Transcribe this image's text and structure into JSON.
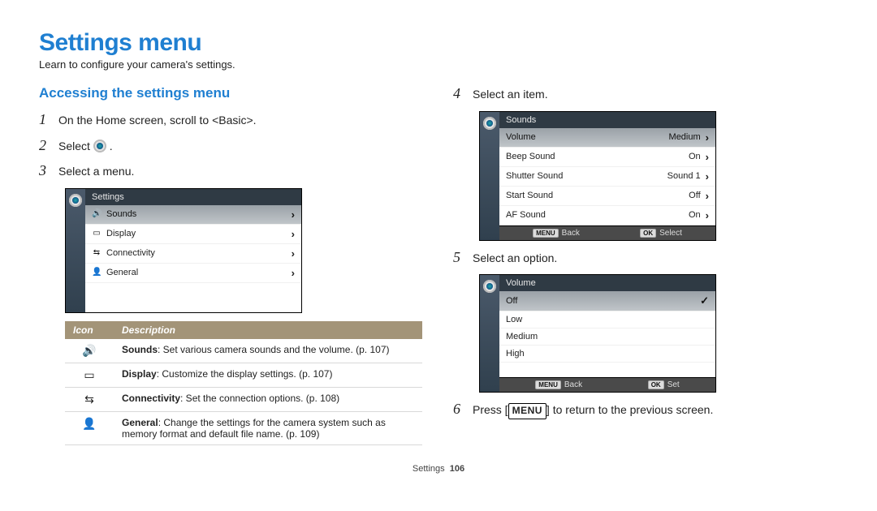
{
  "title": "Settings menu",
  "subtitle": "Learn to configure your camera's settings.",
  "section_heading": "Accessing the settings menu",
  "steps": {
    "s1": "On the Home screen, scroll to <Basic>.",
    "s2_pre": "Select",
    "s2_post": ".",
    "s3": "Select a menu.",
    "s4": "Select an item.",
    "s5": "Select an option.",
    "s6_pre": "Press [",
    "s6_btn": "MENU",
    "s6_post": "] to return to the previous screen."
  },
  "screen1": {
    "title": "Settings",
    "rows": [
      {
        "label": "Sounds",
        "selected": true
      },
      {
        "label": "Display",
        "selected": false
      },
      {
        "label": "Connectivity",
        "selected": false
      },
      {
        "label": "General",
        "selected": false
      }
    ]
  },
  "screen2": {
    "title": "Sounds",
    "rows": [
      {
        "label": "Volume",
        "value": "Medium",
        "selected": true
      },
      {
        "label": "Beep Sound",
        "value": "On",
        "selected": false
      },
      {
        "label": "Shutter Sound",
        "value": "Sound 1",
        "selected": false
      },
      {
        "label": "Start Sound",
        "value": "Off",
        "selected": false
      },
      {
        "label": "AF Sound",
        "value": "On",
        "selected": false
      }
    ],
    "footer": {
      "back": "Back",
      "menu_badge": "MENU",
      "ok_badge": "OK",
      "select": "Select"
    }
  },
  "screen3": {
    "title": "Volume",
    "rows": [
      {
        "label": "Off",
        "selected": true
      },
      {
        "label": "Low",
        "selected": false
      },
      {
        "label": "Medium",
        "selected": false
      },
      {
        "label": "High",
        "selected": false
      }
    ],
    "footer": {
      "back": "Back",
      "menu_badge": "MENU",
      "ok_badge": "OK",
      "set": "Set"
    }
  },
  "desc_table": {
    "h1": "Icon",
    "h2": "Description",
    "rows": [
      {
        "b": "Sounds",
        "t": ": Set various camera sounds and the volume. (p. 107)"
      },
      {
        "b": "Display",
        "t": ": Customize the display settings. (p. 107)"
      },
      {
        "b": "Connectivity",
        "t": ": Set the connection options. (p. 108)"
      },
      {
        "b": "General",
        "t": ": Change the settings for the camera system such as memory format and default file name. (p. 109)"
      }
    ]
  },
  "footer": {
    "label": "Settings",
    "page": "106"
  }
}
